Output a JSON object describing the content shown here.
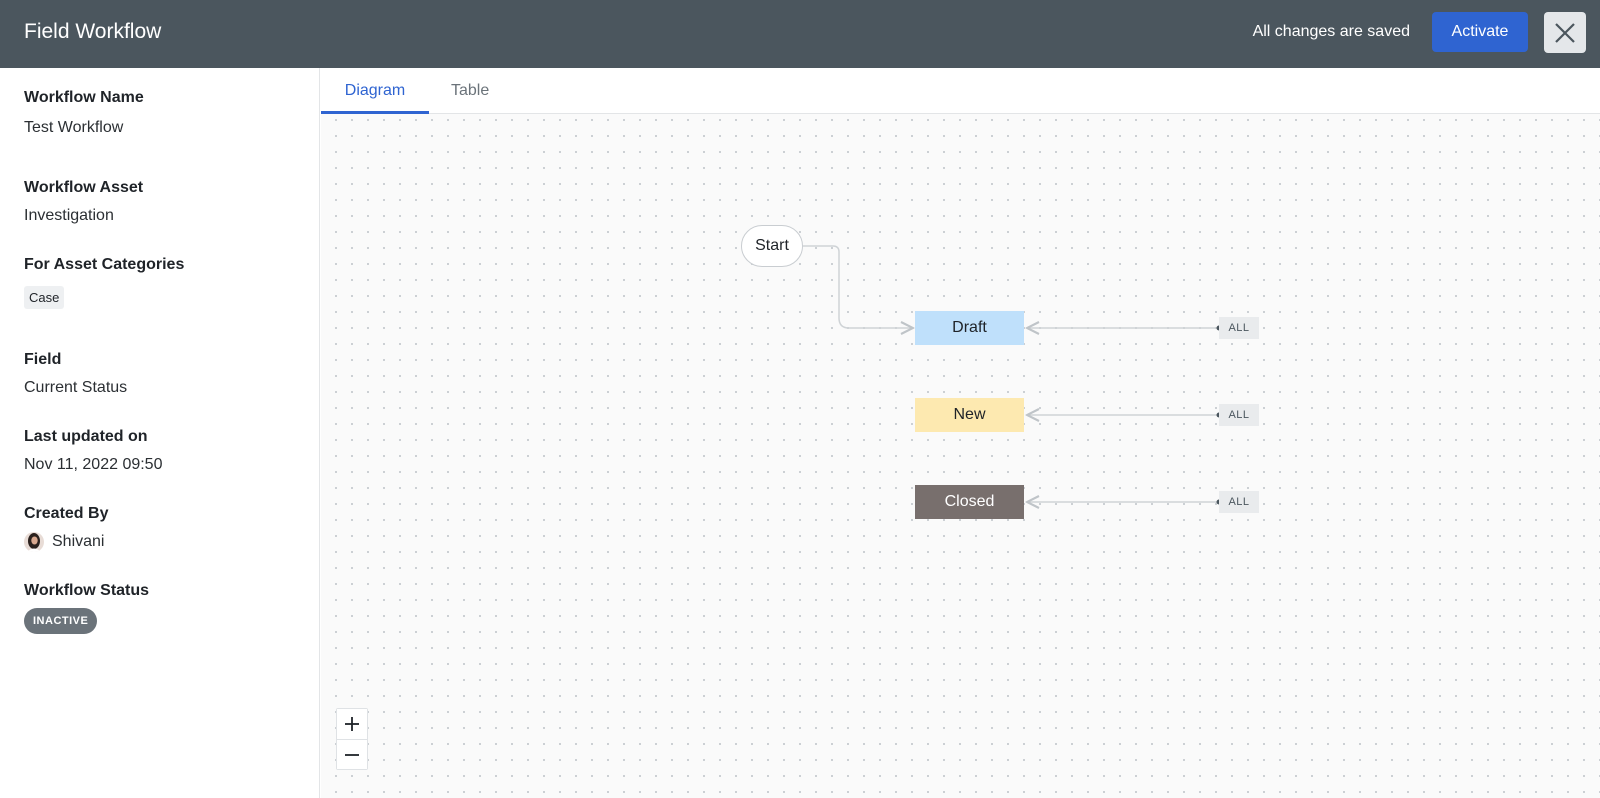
{
  "header": {
    "title": "Field Workflow",
    "save_status": "All changes are saved",
    "activate_label": "Activate",
    "close_icon": "close-icon"
  },
  "sidebar": {
    "workflow_name": {
      "label": "Workflow Name",
      "value": "Test Workflow"
    },
    "workflow_asset": {
      "label": "Workflow Asset",
      "value": "Investigation"
    },
    "asset_categories": {
      "label": "For Asset Categories",
      "items": [
        "Case"
      ]
    },
    "field": {
      "label": "Field",
      "value": "Current Status"
    },
    "last_updated": {
      "label": "Last updated on",
      "value": "Nov 11, 2022 09:50"
    },
    "created_by": {
      "label": "Created By",
      "name": "Shivani",
      "avatar_icon": "user-avatar"
    },
    "workflow_status": {
      "label": "Workflow Status",
      "value": "INACTIVE"
    }
  },
  "tabs": [
    {
      "label": "Diagram",
      "active": true
    },
    {
      "label": "Table",
      "active": false
    }
  ],
  "diagram": {
    "start_label": "Start",
    "states": [
      {
        "label": "Draft",
        "color": "#bfe0fb"
      },
      {
        "label": "New",
        "color": "#fde9b0"
      },
      {
        "label": "Closed",
        "color": "#786f6d"
      }
    ],
    "transition_tag": "ALL",
    "zoom_in_icon": "plus-icon",
    "zoom_out_icon": "minus-icon"
  },
  "colors": {
    "header_bg": "#4b565e",
    "accent": "#2f64d1",
    "status_badge": "#6b737a"
  }
}
